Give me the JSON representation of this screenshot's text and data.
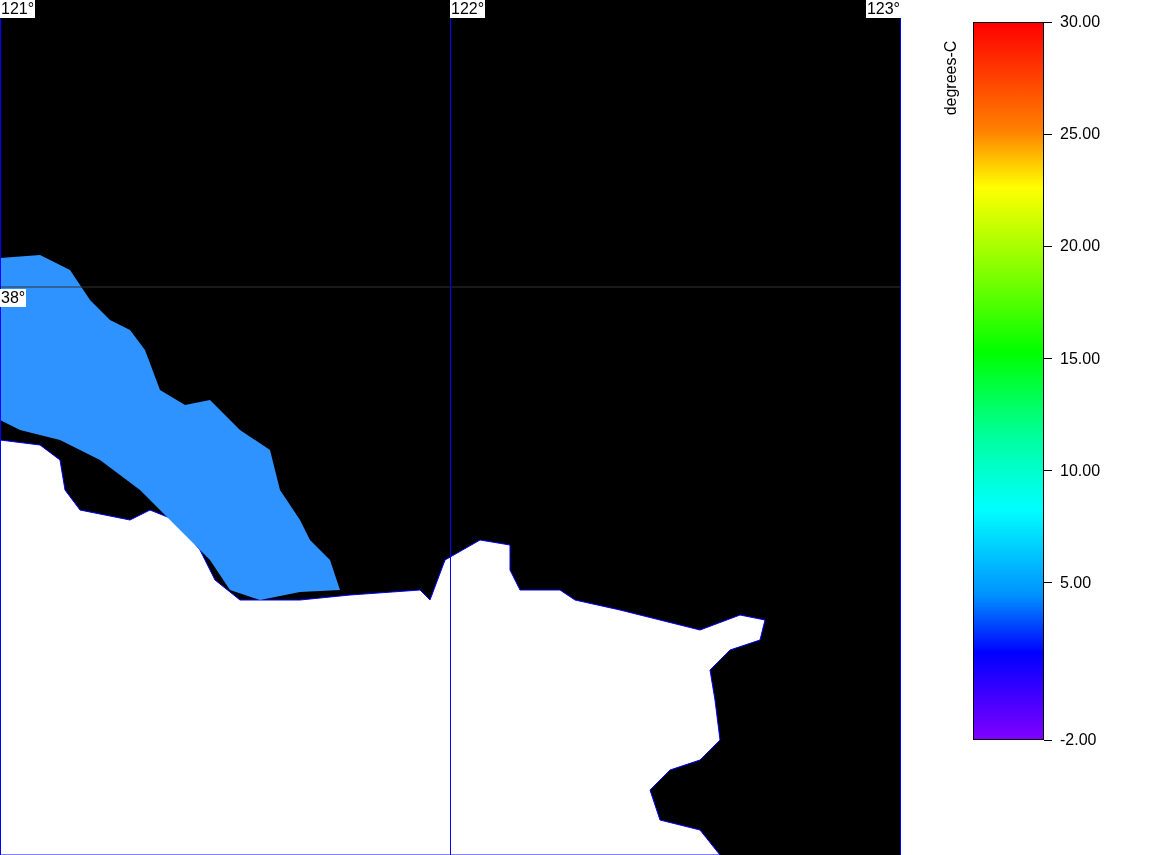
{
  "map": {
    "longitude_labels": [
      "121°",
      "122°",
      "123°"
    ],
    "latitude_labels": [
      "38°"
    ]
  },
  "color_scale": {
    "title": "degrees-C",
    "ticks": [
      "30.00",
      "25.00",
      "20.00",
      "15.00",
      "10.00",
      "5.00",
      "-2.00"
    ]
  }
}
